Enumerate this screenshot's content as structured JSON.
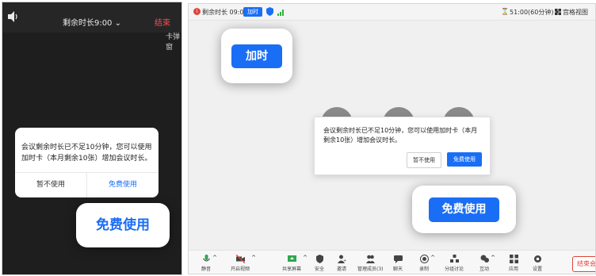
{
  "colors": {
    "accent": "#1a6ef5",
    "danger": "#e0453a",
    "phone_bg": "#1e1e1f"
  },
  "phone": {
    "timer": "剩余时长9:00",
    "end": "结束",
    "partial_text": "卡弹窗",
    "dialog": {
      "message": "会议剩余时长已不足10分钟，您可以使用加时卡（本月剩余10张）增加会议时长。",
      "cancel": "暂不使用",
      "confirm": "免费使用"
    },
    "callout": "免费使用"
  },
  "desktop": {
    "toolbar": {
      "remaining": "剩余时长 09:00",
      "extend_tag": "加时",
      "duration": "51:00(60分钟)",
      "grid_view": "宫格视图"
    },
    "dialog": {
      "message": "会议剩余时长已不足10分钟，您可以使用加时卡（本月剩余10张）增加会议时长。",
      "cancel": "暂不使用",
      "confirm": "免费使用"
    },
    "callout_extend": "加时",
    "callout_free": "免费使用",
    "bottom_tools": [
      {
        "label": "静音",
        "icon": "mic-icon"
      },
      {
        "label": "开启视频",
        "icon": "camera-icon"
      },
      {
        "label": "共享屏幕",
        "icon": "share-screen-icon"
      },
      {
        "label": "安全",
        "icon": "shield-icon"
      },
      {
        "label": "邀请",
        "icon": "invite-icon"
      },
      {
        "label": "管理成员(3)",
        "icon": "members-icon"
      },
      {
        "label": "聊天",
        "icon": "chat-icon"
      },
      {
        "label": "录制",
        "icon": "record-icon"
      },
      {
        "label": "分组讨论",
        "icon": "breakout-icon"
      },
      {
        "label": "应用",
        "icon": "apps-icon"
      },
      {
        "label": "设置",
        "icon": "settings-icon"
      }
    ],
    "partial_tool": "互动",
    "end_button": "结束会"
  }
}
